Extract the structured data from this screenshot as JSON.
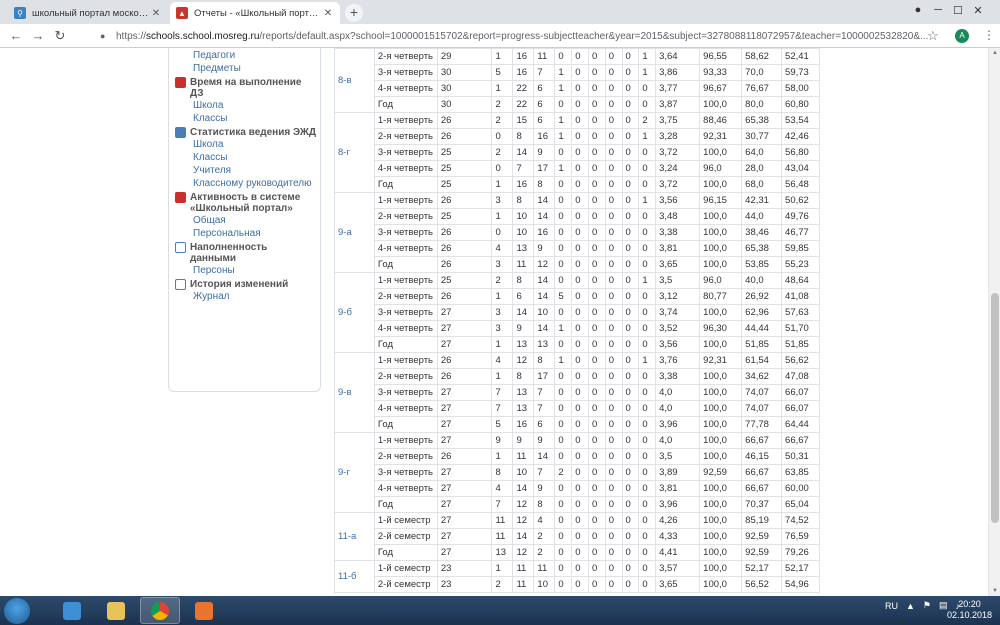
{
  "tabs": [
    {
      "title": "школьный портал московской",
      "close": "✕"
    },
    {
      "title": "Отчеты - «Школьный портал»",
      "close": "✕"
    }
  ],
  "newtab": "+",
  "window_controls": {
    "minimize": "─",
    "maximize": "☐",
    "close": "✕"
  },
  "toolbar": {
    "back": "←",
    "forward": "→",
    "reload": "↻",
    "lock": "🔒",
    "star": "☆",
    "avatar": "A",
    "menu": "⋮"
  },
  "url": {
    "scheme": "https://",
    "host": "schools.school.mosreg.ru",
    "path": "/reports/default.aspx?school=1000001515702&report=progress-subjectteacher&year=2015&subject=3278088118072957&teacher=1000002532820&..."
  },
  "sidebar": {
    "pre_links": [
      "Педагоги",
      "Предметы"
    ],
    "sections": [
      {
        "icon": "red-shield-icon",
        "title": "Время на выполнение ДЗ",
        "links": [
          "Школа",
          "Классы"
        ]
      },
      {
        "icon": "book-icon",
        "title": "Статистика ведения ЭЖД",
        "links": [
          "Школа",
          "Классы",
          "Учителя",
          "Классному руководителю"
        ]
      },
      {
        "icon": "red-shield-icon",
        "title": "Активность в системе «Школьный портал»",
        "links": [
          "Общая",
          "Персональная"
        ]
      },
      {
        "icon": "table-icon",
        "title": "Наполненность данными",
        "links": [
          "Персоны"
        ]
      },
      {
        "icon": "table-icon",
        "title": "История изменений",
        "links": [
          "Журнал"
        ]
      }
    ]
  },
  "table": {
    "groups": [
      {
        "cls": "8-в",
        "rows": [
          [
            "2-я четверть",
            "29",
            "1",
            "16",
            "11",
            "0",
            "0",
            "0",
            "0",
            "0",
            "1",
            "3,64",
            "96,55",
            "58,62",
            "52,41"
          ],
          [
            "3-я четверть",
            "30",
            "5",
            "16",
            "7",
            "1",
            "0",
            "0",
            "0",
            "0",
            "1",
            "3,86",
            "93,33",
            "70,0",
            "59,73"
          ],
          [
            "4-я четверть",
            "30",
            "1",
            "22",
            "6",
            "1",
            "0",
            "0",
            "0",
            "0",
            "0",
            "3,77",
            "96,67",
            "76,67",
            "58,00"
          ],
          [
            "Год",
            "30",
            "2",
            "22",
            "6",
            "0",
            "0",
            "0",
            "0",
            "0",
            "0",
            "3,87",
            "100,0",
            "80,0",
            "60,80"
          ]
        ]
      },
      {
        "cls": "8-г",
        "rows": [
          [
            "1-я четверть",
            "26",
            "2",
            "15",
            "6",
            "1",
            "0",
            "0",
            "0",
            "0",
            "2",
            "3,75",
            "88,46",
            "65,38",
            "53,54"
          ],
          [
            "2-я четверть",
            "26",
            "0",
            "8",
            "16",
            "1",
            "0",
            "0",
            "0",
            "0",
            "1",
            "3,28",
            "92,31",
            "30,77",
            "42,46"
          ],
          [
            "3-я четверть",
            "25",
            "2",
            "14",
            "9",
            "0",
            "0",
            "0",
            "0",
            "0",
            "0",
            "3,72",
            "100,0",
            "64,0",
            "56,80"
          ],
          [
            "4-я четверть",
            "25",
            "0",
            "7",
            "17",
            "1",
            "0",
            "0",
            "0",
            "0",
            "0",
            "3,24",
            "96,0",
            "28,0",
            "43,04"
          ],
          [
            "Год",
            "25",
            "1",
            "16",
            "8",
            "0",
            "0",
            "0",
            "0",
            "0",
            "0",
            "3,72",
            "100,0",
            "68,0",
            "56,48"
          ]
        ]
      },
      {
        "cls": "9-а",
        "rows": [
          [
            "1-я четверть",
            "26",
            "3",
            "8",
            "14",
            "0",
            "0",
            "0",
            "0",
            "0",
            "1",
            "3,56",
            "96,15",
            "42,31",
            "50,62"
          ],
          [
            "2-я четверть",
            "25",
            "1",
            "10",
            "14",
            "0",
            "0",
            "0",
            "0",
            "0",
            "0",
            "3,48",
            "100,0",
            "44,0",
            "49,76"
          ],
          [
            "3-я четверть",
            "26",
            "0",
            "10",
            "16",
            "0",
            "0",
            "0",
            "0",
            "0",
            "0",
            "3,38",
            "100,0",
            "38,46",
            "46,77"
          ],
          [
            "4-я четверть",
            "26",
            "4",
            "13",
            "9",
            "0",
            "0",
            "0",
            "0",
            "0",
            "0",
            "3,81",
            "100,0",
            "65,38",
            "59,85"
          ],
          [
            "Год",
            "26",
            "3",
            "11",
            "12",
            "0",
            "0",
            "0",
            "0",
            "0",
            "0",
            "3,65",
            "100,0",
            "53,85",
            "55,23"
          ]
        ]
      },
      {
        "cls": "9-б",
        "rows": [
          [
            "1-я четверть",
            "25",
            "2",
            "8",
            "14",
            "0",
            "0",
            "0",
            "0",
            "0",
            "1",
            "3,5",
            "96,0",
            "40,0",
            "48,64"
          ],
          [
            "2-я четверть",
            "26",
            "1",
            "6",
            "14",
            "5",
            "0",
            "0",
            "0",
            "0",
            "0",
            "3,12",
            "80,77",
            "26,92",
            "41,08"
          ],
          [
            "3-я четверть",
            "27",
            "3",
            "14",
            "10",
            "0",
            "0",
            "0",
            "0",
            "0",
            "0",
            "3,74",
            "100,0",
            "62,96",
            "57,63"
          ],
          [
            "4-я четверть",
            "27",
            "3",
            "9",
            "14",
            "1",
            "0",
            "0",
            "0",
            "0",
            "0",
            "3,52",
            "96,30",
            "44,44",
            "51,70"
          ],
          [
            "Год",
            "27",
            "1",
            "13",
            "13",
            "0",
            "0",
            "0",
            "0",
            "0",
            "0",
            "3,56",
            "100,0",
            "51,85",
            "51,85"
          ]
        ]
      },
      {
        "cls": "9-в",
        "rows": [
          [
            "1-я четверть",
            "26",
            "4",
            "12",
            "8",
            "1",
            "0",
            "0",
            "0",
            "0",
            "1",
            "3,76",
            "92,31",
            "61,54",
            "56,62"
          ],
          [
            "2-я четверть",
            "26",
            "1",
            "8",
            "17",
            "0",
            "0",
            "0",
            "0",
            "0",
            "0",
            "3,38",
            "100,0",
            "34,62",
            "47,08"
          ],
          [
            "3-я четверть",
            "27",
            "7",
            "13",
            "7",
            "0",
            "0",
            "0",
            "0",
            "0",
            "0",
            "4,0",
            "100,0",
            "74,07",
            "66,07"
          ],
          [
            "4-я четверть",
            "27",
            "7",
            "13",
            "7",
            "0",
            "0",
            "0",
            "0",
            "0",
            "0",
            "4,0",
            "100,0",
            "74,07",
            "66,07"
          ],
          [
            "Год",
            "27",
            "5",
            "16",
            "6",
            "0",
            "0",
            "0",
            "0",
            "0",
            "0",
            "3,96",
            "100,0",
            "77,78",
            "64,44"
          ]
        ]
      },
      {
        "cls": "9-г",
        "rows": [
          [
            "1-я четверть",
            "27",
            "9",
            "9",
            "9",
            "0",
            "0",
            "0",
            "0",
            "0",
            "0",
            "4,0",
            "100,0",
            "66,67",
            "66,67"
          ],
          [
            "2-я четверть",
            "26",
            "1",
            "11",
            "14",
            "0",
            "0",
            "0",
            "0",
            "0",
            "0",
            "3,5",
            "100,0",
            "46,15",
            "50,31"
          ],
          [
            "3-я четверть",
            "27",
            "8",
            "10",
            "7",
            "2",
            "0",
            "0",
            "0",
            "0",
            "0",
            "3,89",
            "92,59",
            "66,67",
            "63,85"
          ],
          [
            "4-я четверть",
            "27",
            "4",
            "14",
            "9",
            "0",
            "0",
            "0",
            "0",
            "0",
            "0",
            "3,81",
            "100,0",
            "66,67",
            "60,00"
          ],
          [
            "Год",
            "27",
            "7",
            "12",
            "8",
            "0",
            "0",
            "0",
            "0",
            "0",
            "0",
            "3,96",
            "100,0",
            "70,37",
            "65,04"
          ]
        ]
      },
      {
        "cls": "11-а",
        "rows": [
          [
            "1-й семестр",
            "27",
            "11",
            "12",
            "4",
            "0",
            "0",
            "0",
            "0",
            "0",
            "0",
            "4,26",
            "100,0",
            "85,19",
            "74,52"
          ],
          [
            "2-й семестр",
            "27",
            "11",
            "14",
            "2",
            "0",
            "0",
            "0",
            "0",
            "0",
            "0",
            "4,33",
            "100,0",
            "92,59",
            "76,59"
          ],
          [
            "Год",
            "27",
            "13",
            "12",
            "2",
            "0",
            "0",
            "0",
            "0",
            "0",
            "0",
            "4,41",
            "100,0",
            "92,59",
            "79,26"
          ]
        ]
      },
      {
        "cls": "11-б",
        "rows": [
          [
            "1-й семестр",
            "23",
            "1",
            "11",
            "11",
            "0",
            "0",
            "0",
            "0",
            "0",
            "0",
            "3,57",
            "100,0",
            "52,17",
            "52,17"
          ],
          [
            "2-й семестр",
            "23",
            "2",
            "11",
            "10",
            "0",
            "0",
            "0",
            "0",
            "0",
            "0",
            "3,65",
            "100,0",
            "56,52",
            "54,96"
          ]
        ]
      }
    ]
  },
  "taskbar": {
    "apps": [
      "ie-icon",
      "explorer-icon",
      "chrome-icon",
      "media-player-icon"
    ],
    "lang": "RU",
    "time": "20:20",
    "date": "02.10.2018"
  }
}
